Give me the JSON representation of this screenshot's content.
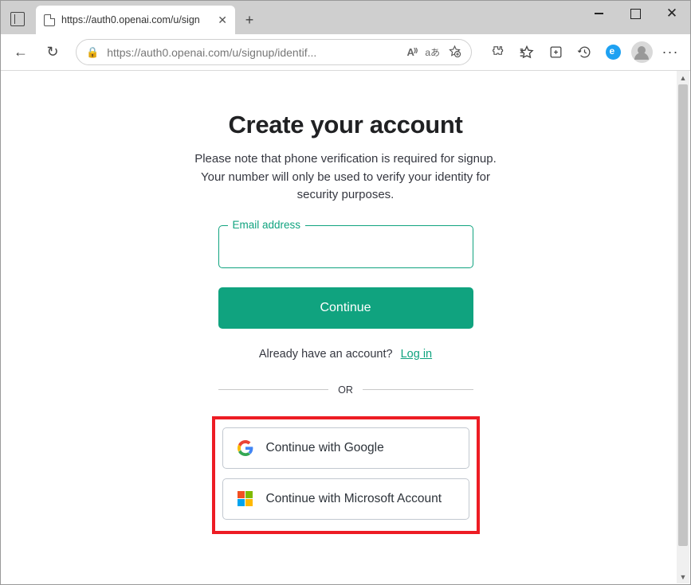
{
  "browser": {
    "tab_title": "https://auth0.openai.com/u/sign",
    "url_display": "https://auth0.openai.com/u/signup/identif...",
    "read_aloud_label": "A⁾⁾",
    "translate_label": "aあ"
  },
  "page": {
    "heading": "Create your account",
    "subtitle": "Please note that phone verification is required for signup. Your number will only be used to verify your identity for security purposes.",
    "email_label": "Email address",
    "email_value": "",
    "continue_label": "Continue",
    "login_prompt": "Already have an account?",
    "login_link": "Log in",
    "divider_text": "OR",
    "google_label": "Continue with Google",
    "microsoft_label": "Continue with Microsoft Account"
  }
}
